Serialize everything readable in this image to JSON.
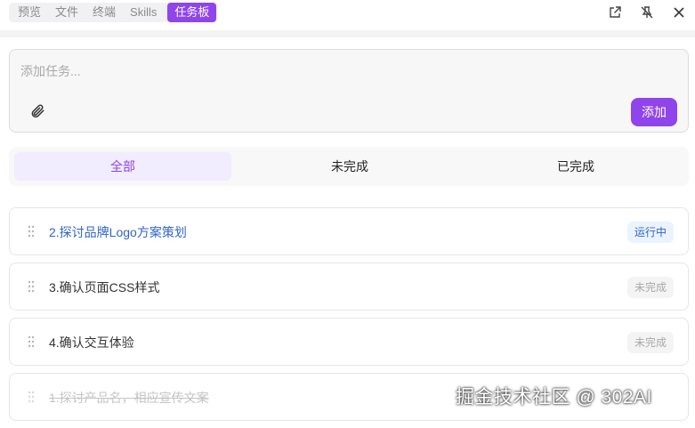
{
  "tabs": [
    "预览",
    "文件",
    "终端",
    "Skills",
    "任务板"
  ],
  "active_tab_index": 4,
  "top_icons": [
    "external-link-icon",
    "pin-off-icon",
    "close-icon"
  ],
  "input": {
    "placeholder": "添加任务...",
    "value": "",
    "add_label": "添加"
  },
  "filters": [
    "全部",
    "未完成",
    "已完成"
  ],
  "active_filter_index": 0,
  "tasks": [
    {
      "text": "2.探讨品牌Logo方案策划",
      "status": "运行中",
      "state": "running"
    },
    {
      "text": "3.确认页面CSS样式",
      "status": "未完成",
      "state": "todo"
    },
    {
      "text": "4.确认交互体验",
      "status": "未完成",
      "state": "todo"
    },
    {
      "text": "1.探讨产品名，相应宣传文案",
      "status": "",
      "state": "done"
    }
  ],
  "watermark": "掘金技术社区 @ 302AI",
  "colors": {
    "accent": "#8f44ec",
    "running": "#2f65c8",
    "muted": "#a8a8a8"
  }
}
